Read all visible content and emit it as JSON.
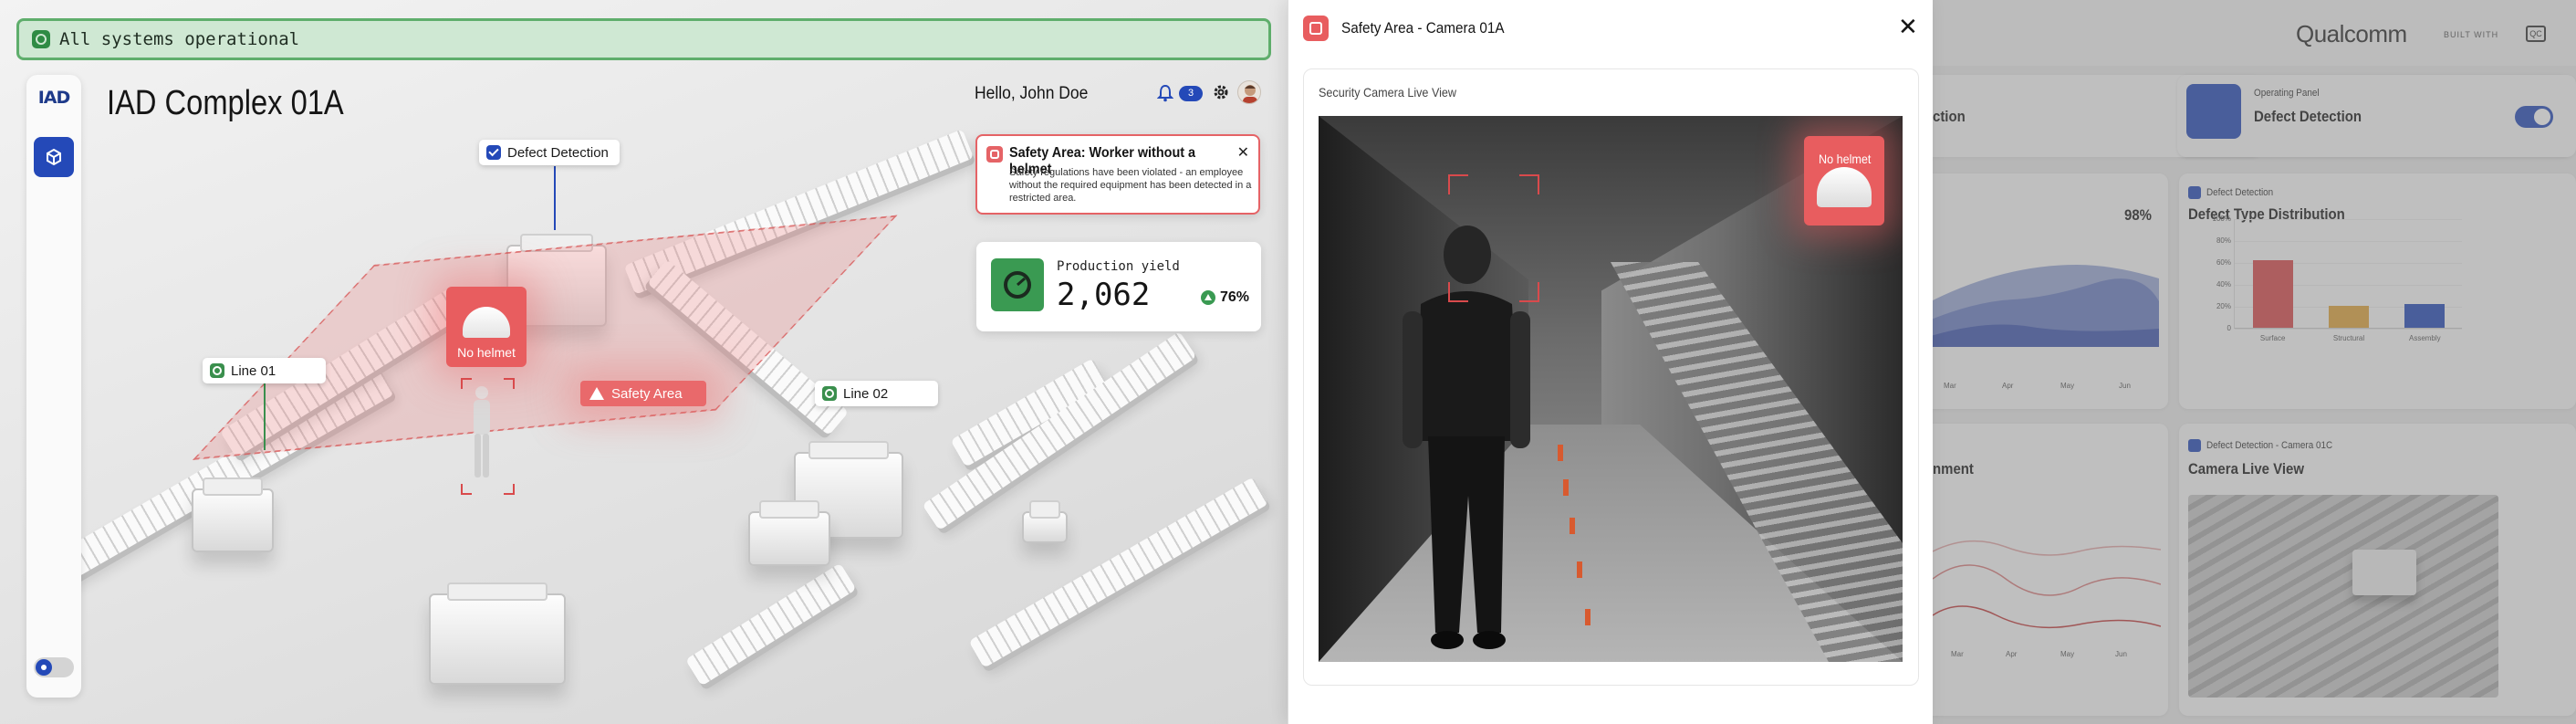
{
  "status": {
    "text": "All systems operational"
  },
  "app": {
    "logo_text": "IAD",
    "title": "IAD Complex 01A"
  },
  "header": {
    "greeting": "Hello, John Doe",
    "notification_count": "3"
  },
  "scene_tags": {
    "defect_detection": "Defect Detection",
    "line_01": "Line 01",
    "line_02": "Line 02",
    "safety_area": "Safety Area",
    "no_helmet": "No helmet"
  },
  "alert": {
    "title": "Safety Area: Worker without a helmet",
    "body": "Safety regulations have been violated - an employee without the required equipment has been detected in a restricted area."
  },
  "production_yield": {
    "label": "Production yield",
    "value": "2,062",
    "percent": "76%"
  },
  "modal": {
    "title": "Safety Area - Camera 01A",
    "feed_label": "Security Camera Live View",
    "marker_label": "No helmet"
  },
  "dashboard": {
    "brand": "Qualcomm",
    "built_with": "BUILT WITH",
    "mini_logo": "QC",
    "op_panel_sub": "Operating Panel",
    "op_panel_title": "Defect Detection",
    "card1_title_partial": "ction",
    "yield_pct": "98%",
    "defect_sub": "Defect Detection",
    "defect_title": "Defect Type Distribution",
    "nment_partial": "nment",
    "camera_sub": "Defect Detection - Camera 01C",
    "camera_title": "Camera Live View",
    "area_months": [
      "Mar",
      "Apr",
      "May",
      "Jun"
    ],
    "line_months": [
      "Mar",
      "Apr",
      "May",
      "Jun"
    ]
  },
  "chart_data": {
    "type": "bar",
    "title": "Defect Type Distribution",
    "categories": [
      "Surface",
      "Structural",
      "Assembly"
    ],
    "values": [
      62,
      20,
      22
    ],
    "ylim": [
      0,
      100
    ],
    "yticks": [
      "100%",
      "80%",
      "60%",
      "40%",
      "20%",
      "0"
    ],
    "colors": [
      "#d94a4c",
      "#e0a43b",
      "#2449b8"
    ]
  }
}
